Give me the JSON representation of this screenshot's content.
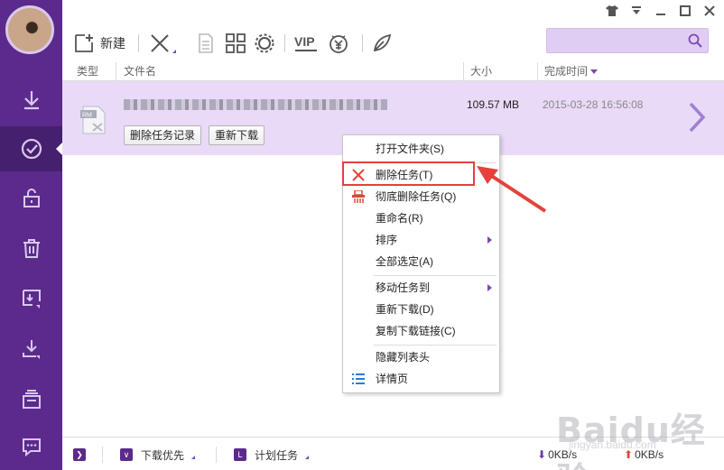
{
  "toolbar": {
    "new_label": "新建",
    "search_placeholder": ""
  },
  "columns": {
    "type": "类型",
    "name": "文件名",
    "size": "大小",
    "finish_time": "完成时间"
  },
  "task": {
    "file_type_badge": "RM",
    "size": "109.57 MB",
    "finish_time": "2015-03-28 16:56:08",
    "btn_delete_record": "删除任务记录",
    "btn_redownload": "重新下载"
  },
  "context_menu": {
    "items": [
      {
        "label": "打开文件夹(S)",
        "icon": ""
      },
      {
        "label": "删除任务(T)",
        "icon": "x-icon"
      },
      {
        "label": "彻底删除任务(Q)",
        "icon": "shredder-icon"
      },
      {
        "label": "重命名(R)",
        "icon": ""
      },
      {
        "label": "排序",
        "icon": "",
        "submenu": true
      },
      {
        "label": "全部选定(A)",
        "icon": ""
      },
      {
        "label": "移动任务到",
        "icon": "",
        "submenu": true
      },
      {
        "label": "重新下载(D)",
        "icon": ""
      },
      {
        "label": "复制下载链接(C)",
        "icon": ""
      },
      {
        "label": "隐藏列表头",
        "icon": ""
      },
      {
        "label": "详情页",
        "icon": "list-icon"
      }
    ]
  },
  "status": {
    "download_priority": "下载优先",
    "scheduled_task": "计划任务",
    "download_speed": "0KB/s",
    "upload_speed": "0KB/s"
  },
  "watermark": {
    "text": "Baidu经验",
    "sub": "jingyan.baidu.com"
  },
  "colors": {
    "sidebar": "#5b2a8c",
    "row_selected": "#e9daf8",
    "accent": "#7a4bb3",
    "highlight": "#e5413a"
  }
}
